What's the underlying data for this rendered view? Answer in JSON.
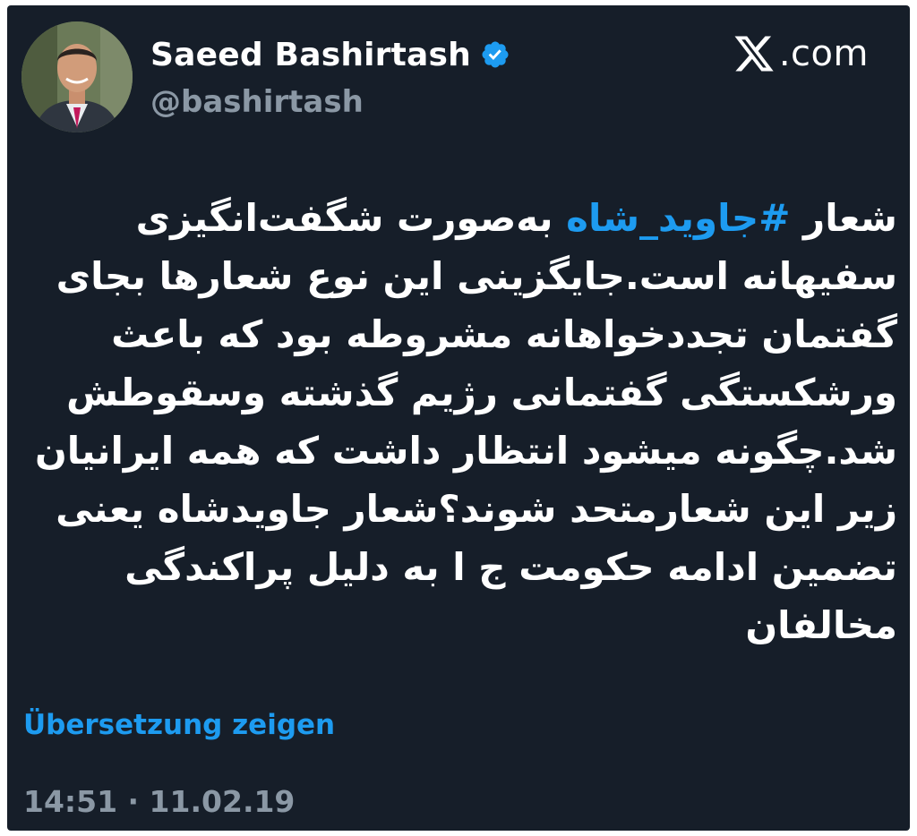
{
  "author": {
    "display_name": "Saeed Bashirtash",
    "handle": "@bashirtash",
    "verified": true
  },
  "brand": {
    "text": ".com",
    "logo_icon": "x-logo-icon"
  },
  "tweet": {
    "line1_before": "شعار ",
    "hashtag": "#جاوید_شاه",
    "line1_after": " به‌صورت شگفت‌انگیزی",
    "lines": [
      "سفیهانه است.جایگزینی این نوع شعارها بجای",
      "گفتمان تجددخواهانه مشروطه بود که باعث",
      "ورشکستگی گفتمانی رژیم گذشته وسقوطش",
      "شد.چگونه میشود انتظار داشت که همه ایرانیان",
      "زیر این شعارمتحد شوند؟شعار جاویدشاه یعنی",
      "تضمین ادامه حکومت ج ا به دلیل پراکندگی",
      "مخالفان"
    ]
  },
  "translate_link": "Übersetzung zeigen",
  "timestamp": "14:51 · 11.02.19",
  "colors": {
    "background": "#161e29",
    "link": "#1d9bf0",
    "muted": "#8b98a5",
    "text": "#ffffff"
  }
}
